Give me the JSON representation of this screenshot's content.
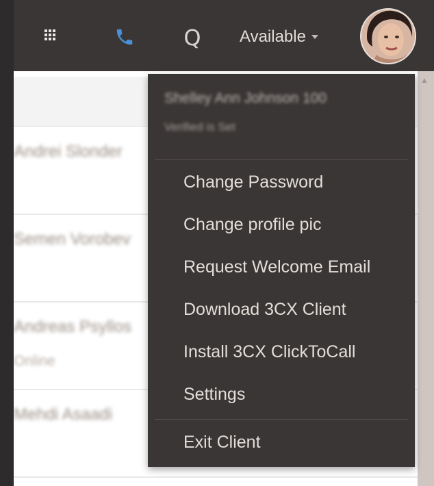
{
  "topbar": {
    "search_label": "Q",
    "status_label": "Available"
  },
  "contacts": [
    {
      "name": "Andrei Slonder",
      "status": ""
    },
    {
      "name": "Semen Vorobev",
      "status": ""
    },
    {
      "name": "Andreas Psyllos",
      "status": "Online"
    },
    {
      "name": "Mehdi Asaadi",
      "status": ""
    }
  ],
  "user_menu": {
    "user_name": "Shelley Ann Johnson 100",
    "user_sub": "Verified is Set",
    "items": [
      {
        "label": "Change Password"
      },
      {
        "label": "Change profile pic"
      },
      {
        "label": "Request Welcome Email"
      },
      {
        "label": "Download 3CX Client"
      },
      {
        "label": "Install 3CX ClickToCall"
      },
      {
        "label": "Settings"
      }
    ],
    "exit_label": "Exit Client"
  },
  "colors": {
    "topbar_bg": "#3a3635",
    "menu_bg": "#3a3635",
    "phone_icon": "#4a90d9",
    "menu_text": "#e3ded9"
  },
  "icons": {
    "apps": "grid-icon",
    "phone": "phone-icon",
    "search": "search-icon",
    "avatar": "avatar"
  }
}
